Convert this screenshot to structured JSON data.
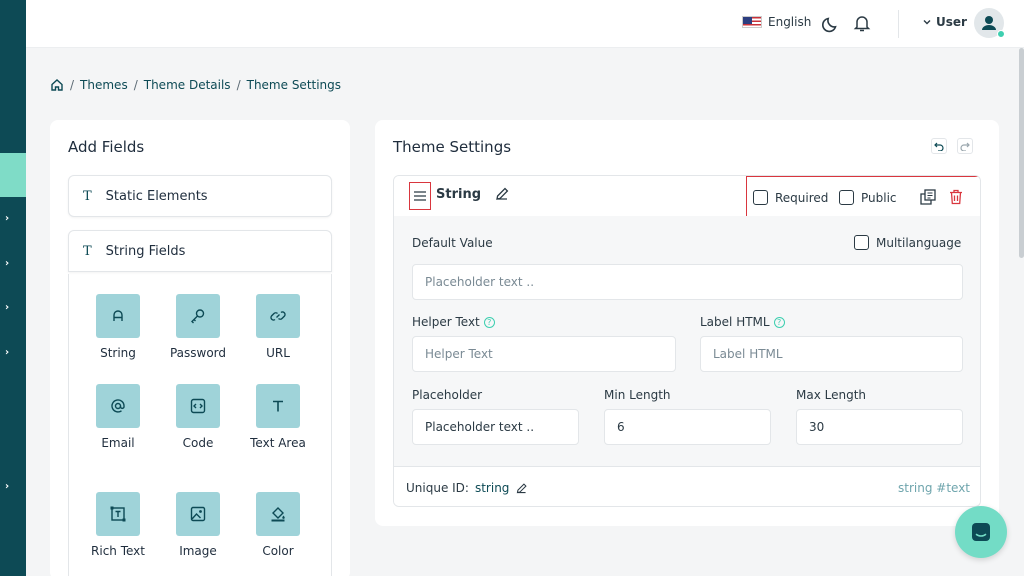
{
  "header": {
    "language": "English",
    "user_label": "User"
  },
  "breadcrumb": [
    "Themes",
    "Theme Details",
    "Theme Settings"
  ],
  "add_fields": {
    "title": "Add Fields",
    "groups": [
      {
        "label": "Static Elements",
        "icon": "T"
      },
      {
        "label": "String Fields",
        "icon": "T"
      }
    ],
    "items": [
      {
        "label": "String",
        "icon": "letter-a-icon"
      },
      {
        "label": "Password",
        "icon": "key-icon"
      },
      {
        "label": "URL",
        "icon": "link-icon"
      },
      {
        "label": "Email",
        "icon": "at-icon"
      },
      {
        "label": "Code",
        "icon": "code-icon"
      },
      {
        "label": "Text Area",
        "icon": "text-t-icon"
      },
      {
        "label": "Rich Text",
        "icon": "text-box-icon"
      },
      {
        "label": "Image",
        "icon": "image-icon"
      },
      {
        "label": "Color",
        "icon": "paint-bucket-icon"
      }
    ]
  },
  "settings": {
    "title": "Theme Settings",
    "field": {
      "name": "String",
      "required_label": "Required",
      "public_label": "Public",
      "default_value_label": "Default Value",
      "multilanguage_label": "Multilanguage",
      "default_value_placeholder": "Placeholder text ..",
      "helper_text_label": "Helper Text",
      "helper_text_placeholder": "Helper Text",
      "label_html_label": "Label HTML",
      "label_html_placeholder": "Label HTML",
      "placeholder_label": "Placeholder",
      "placeholder_value": "Placeholder text ..",
      "min_length_label": "Min Length",
      "min_length_value": "6",
      "max_length_label": "Max Length",
      "max_length_value": "30",
      "unique_id_label": "Unique ID:",
      "unique_id_value": "string",
      "tags": "string #text"
    }
  },
  "colors": {
    "rail": "#0d4a55",
    "accent": "#3ecfb0",
    "tile": "#9fd3d9",
    "danger": "#d9363e"
  }
}
